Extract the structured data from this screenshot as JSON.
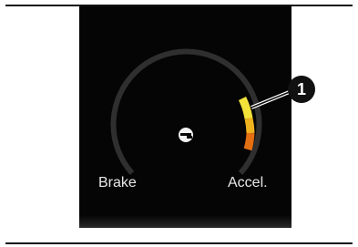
{
  "gauge": {
    "mode_icon": "eco-e-icon",
    "left_label": "Brake",
    "right_label": "Accel.",
    "indicator_colors": [
      "#f3e23a",
      "#f0b21f",
      "#e46f12"
    ],
    "track_color": "#3a3a3a"
  },
  "callout": {
    "number": "1"
  }
}
